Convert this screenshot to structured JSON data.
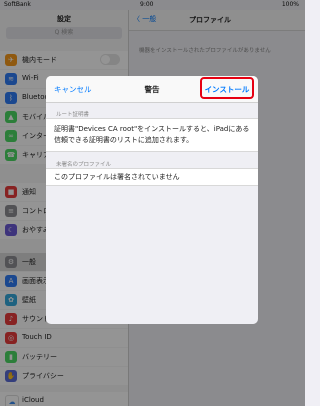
{
  "status": {
    "carrier": "SoftBank",
    "time": "9:00",
    "battery": "100%"
  },
  "sidebar": {
    "title": "設定",
    "search_placeholder": "Q 検索",
    "group1": [
      {
        "label": "機内モード",
        "icon": "airplane-icon",
        "color": "#f79a1d",
        "glyph": "✈"
      },
      {
        "label": "Wi-Fi",
        "icon": "wifi-icon",
        "color": "#2f7cf6",
        "glyph": "≋"
      },
      {
        "label": "Bluetooth",
        "icon": "bluetooth-icon",
        "color": "#2f7cf6",
        "glyph": "ᛒ"
      },
      {
        "label": "モバイル",
        "icon": "cellular-icon",
        "color": "#4cd964",
        "glyph": "▲"
      },
      {
        "label": "インターネット",
        "icon": "hotspot-icon",
        "color": "#4cd964",
        "glyph": "∞"
      },
      {
        "label": "キャリア",
        "icon": "carrier-icon",
        "color": "#4cd964",
        "glyph": "☎"
      }
    ],
    "group2": [
      {
        "label": "通知",
        "icon": "notifications-icon",
        "color": "#e83b3b",
        "glyph": "■"
      },
      {
        "label": "コントロール",
        "icon": "control-center-icon",
        "color": "#8e8e93",
        "glyph": "≡"
      },
      {
        "label": "おやすみ",
        "icon": "moon-icon",
        "color": "#6b5bd6",
        "glyph": "☾"
      }
    ],
    "group3": [
      {
        "label": "一般",
        "icon": "gear-icon",
        "color": "#8e8e93",
        "glyph": "⚙",
        "selected": true
      },
      {
        "label": "画面表示",
        "icon": "display-icon",
        "color": "#2f7cf6",
        "glyph": "A"
      },
      {
        "label": "壁紙",
        "icon": "wallpaper-icon",
        "color": "#35aadc",
        "glyph": "✿"
      },
      {
        "label": "サウンド",
        "icon": "sound-icon",
        "color": "#e83b3b",
        "glyph": "♪"
      },
      {
        "label": "Touch ID",
        "icon": "fingerprint-icon",
        "color": "#e83b3b",
        "glyph": "◎"
      },
      {
        "label": "バッテリー",
        "icon": "battery-icon",
        "color": "#4cd964",
        "glyph": "▮"
      },
      {
        "label": "プライバシー",
        "icon": "hand-icon",
        "color": "#5b6bd6",
        "glyph": "✋"
      }
    ],
    "group4": [
      {
        "label": "iCloud",
        "icon": "cloud-icon",
        "color": "#ffffff",
        "glyph": "☁"
      }
    ]
  },
  "detail": {
    "back_label": "〈 一般",
    "title": "プロファイル",
    "note": "機器をインストールされたプロファイルがありません"
  },
  "dialog": {
    "cancel_label": "キャンセル",
    "title": "警告",
    "install_label": "インストール",
    "section1_label": "ルート証明書",
    "section1_text": "証明書\"Devices CA root\"をインストールすると、iPadにある信頼できる証明書のリストに追加されます。",
    "section2_label": "未署名のプロファイル",
    "section2_text": "このプロファイルは署名されていません"
  }
}
